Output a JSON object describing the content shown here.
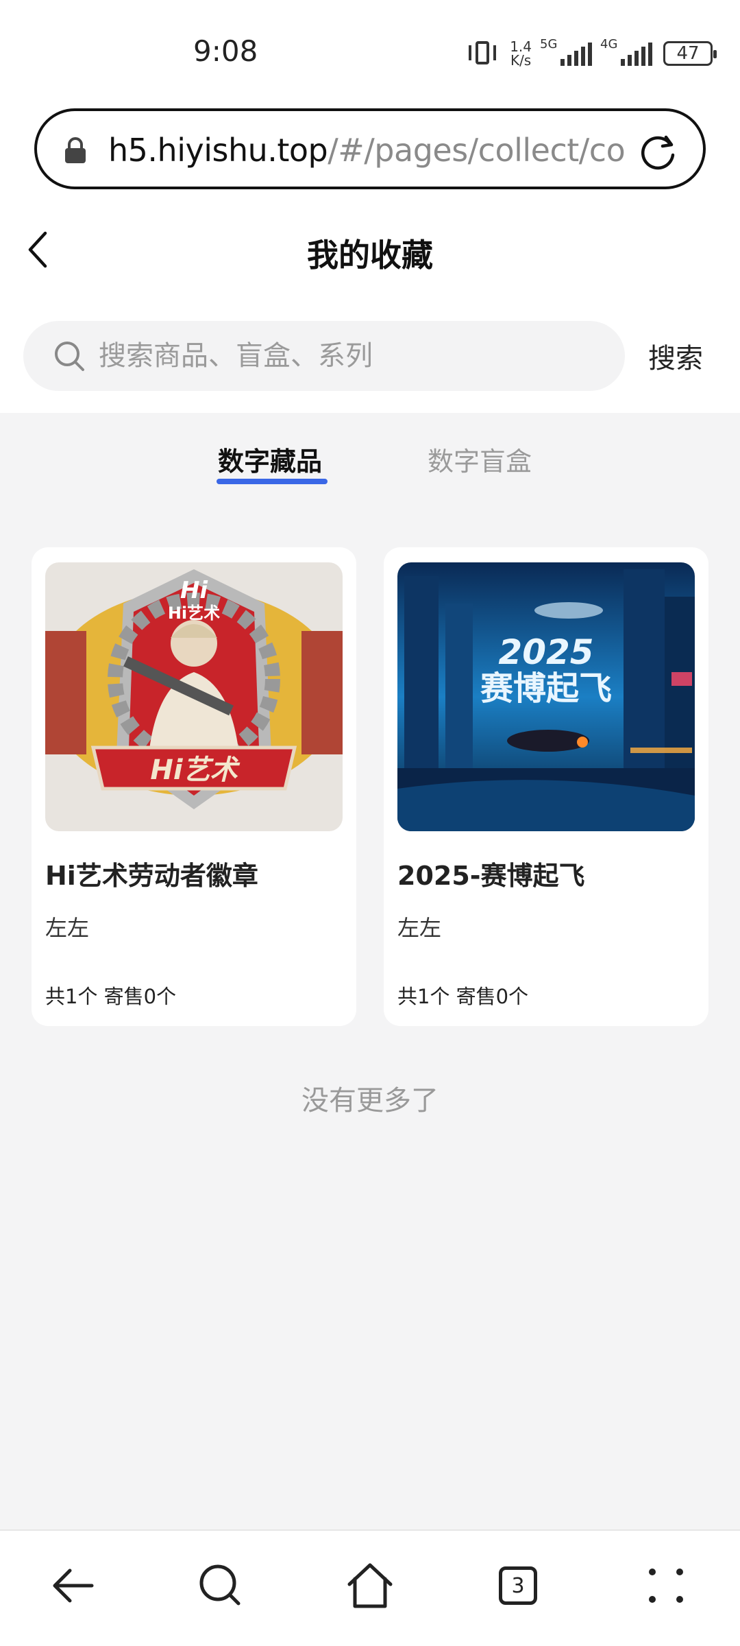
{
  "status_bar": {
    "time": "9:08",
    "net_speed_value": "1.4",
    "net_speed_unit": "K/s",
    "signal_1_label": "5G",
    "signal_2_label": "4G",
    "battery": "47"
  },
  "browser": {
    "url_host": "h5.hiyishu.top",
    "url_path": "/#/pages/collect/co"
  },
  "header": {
    "title": "我的收藏"
  },
  "search": {
    "placeholder": "搜索商品、盲盒、系列",
    "button_label": "搜索"
  },
  "tabs": [
    {
      "label": "数字藏品",
      "active": true
    },
    {
      "label": "数字盲盒",
      "active": false
    }
  ],
  "cards": [
    {
      "image_texts": [
        "Hi",
        "Hi艺术",
        "Hi艺术"
      ],
      "title": "Hi艺术劳动者徽章",
      "author": "左左",
      "count_text": "共1个 寄售0个"
    },
    {
      "image_texts": [
        "2025",
        "赛博起飞"
      ],
      "title": "2025-赛博起飞",
      "author": "左左",
      "count_text": "共1个 寄售0个"
    }
  ],
  "list_end_text": "没有更多了",
  "bottom_nav": {
    "tabs_count": "3",
    "icons": [
      "back-arrow-icon",
      "search-icon",
      "home-icon",
      "tabs-icon",
      "more-icon"
    ]
  },
  "colors": {
    "accent": "#3a67e6",
    "page_background": "#f4f4f5"
  }
}
